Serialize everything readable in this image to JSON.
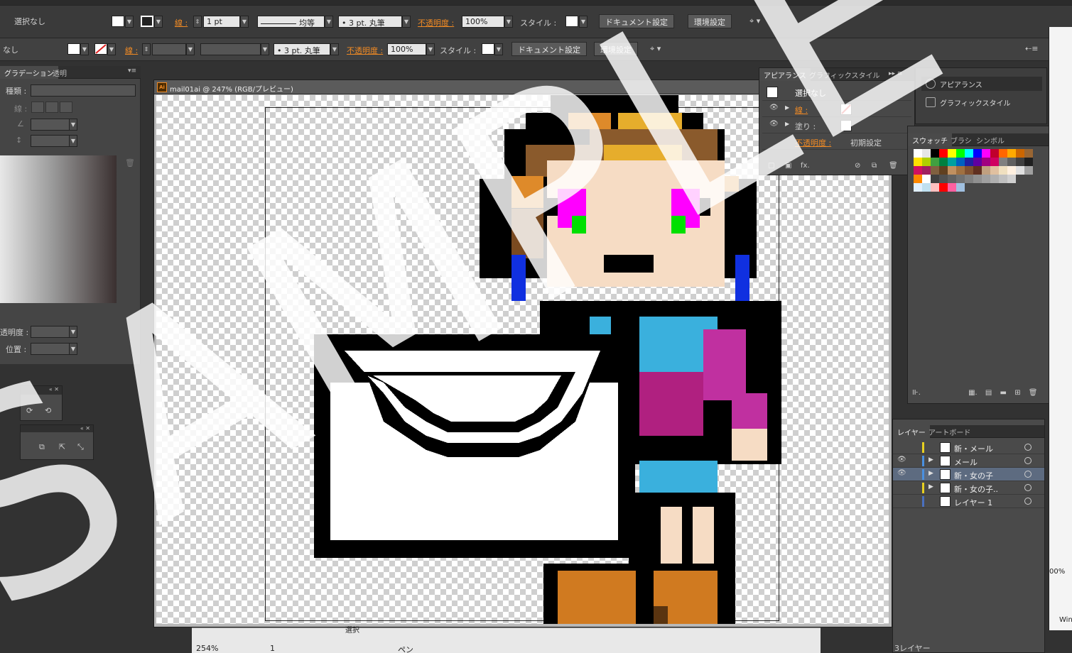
{
  "control_bar_1": {
    "selection": "選択なし",
    "stroke_label": "線 :",
    "stroke_weight": "1 pt",
    "stroke_profile": "均等",
    "brush": "3 pt. 丸筆",
    "opacity_label": "不透明度 :",
    "opacity": "100%",
    "style_label": "スタイル :",
    "doc_settings": "ドキュメント設定",
    "prefs": "環境設定"
  },
  "control_bar_2": {
    "selection": "なし",
    "stroke_label": "線 :",
    "brush": "3 pt. 丸筆",
    "opacity_label": "不透明度 :",
    "opacity": "100%",
    "style_label": "スタイル :",
    "doc_settings": "ドキュメント設定",
    "prefs": "環境設定"
  },
  "gradient_panel": {
    "tabs": [
      "グラデーション",
      "透明"
    ],
    "type_label": "種類 :",
    "stroke_label": "線 :",
    "opacity_label": "透明度 :",
    "position_label": "位置 :"
  },
  "document": {
    "title": "mail01ai @ 247% (RGB/プレビュー)",
    "ai_badge": "Ai"
  },
  "appearance_panel": {
    "tabs": [
      "アピアランス",
      "グラフィックスタイル"
    ],
    "header": "選択なし",
    "stroke": "線 :",
    "fill": "塗り :",
    "opacity": "不透明度 :",
    "opacity_value": "初期設定"
  },
  "collapsed_panels": {
    "appearance": "アピアランス",
    "graphic_styles": "グラフィックスタイル"
  },
  "swatch_panel": {
    "tabs": [
      "スウォッチ",
      "ブラシ",
      "シンボル"
    ]
  },
  "layers_panel": {
    "tabs": [
      "レイヤー",
      "アートボード"
    ],
    "layers": [
      {
        "name": "新・メール",
        "color": "#e8d020",
        "eye": "",
        "expand": ""
      },
      {
        "name": "メール",
        "color": "#4a90e0",
        "eye": "👁",
        "expand": "▶"
      },
      {
        "name": "新・女の子",
        "color": "#4a90e0",
        "eye": "👁",
        "expand": "▶"
      },
      {
        "name": "新・女の子..",
        "color": "#e8d020",
        "eye": "",
        "expand": "▶"
      },
      {
        "name": "レイヤー 1",
        "color": "#4a70c0",
        "eye": "",
        "expand": ""
      }
    ],
    "footer": "3レイヤー"
  },
  "status": {
    "zoom": "254%",
    "page": "1",
    "tool": "ペン",
    "tool2": "選択"
  },
  "right_strip": {
    "zoom": "00%",
    "win": "Win"
  },
  "watermark": "SAMPLE"
}
